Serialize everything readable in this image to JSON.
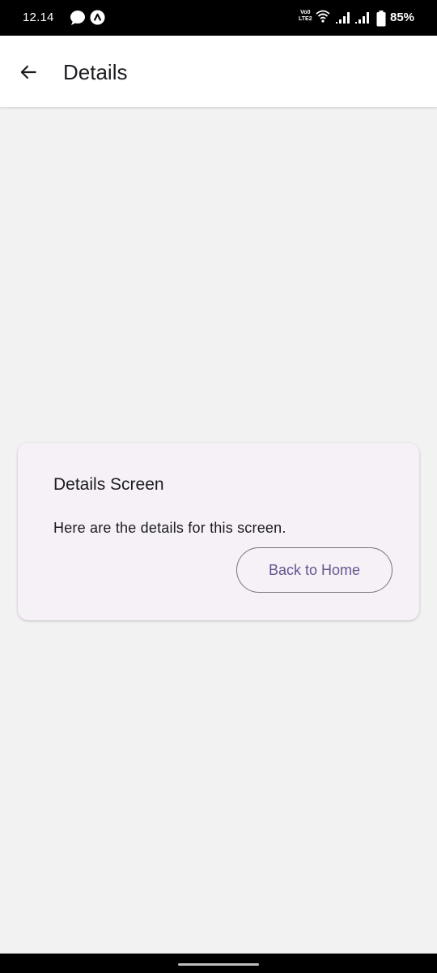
{
  "status_bar": {
    "time": "12.14",
    "network_label_top": "Vo0",
    "network_label_bottom": "LTE2",
    "battery": "85%",
    "icons": [
      "message-icon",
      "app-notification-icon",
      "volte-icon",
      "wifi-icon",
      "signal-icon",
      "signal-icon",
      "battery-icon"
    ]
  },
  "app_bar": {
    "title": "Details",
    "back_icon": "arrow-back-icon"
  },
  "card": {
    "title": "Details Screen",
    "body": "Here are the details for this screen.",
    "button_label": "Back to Home"
  },
  "colors": {
    "background": "#f2f2f2",
    "card": "#f5f1f7",
    "accent": "#65558f",
    "outline": "#79747e"
  }
}
